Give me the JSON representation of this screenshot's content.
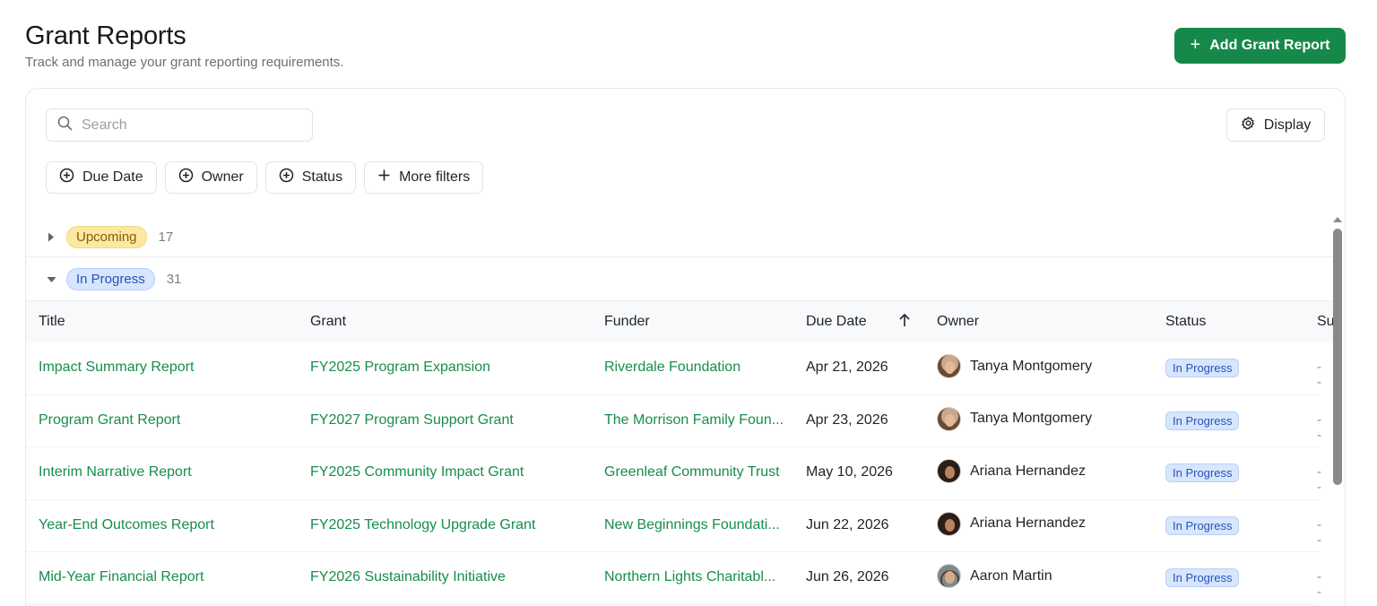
{
  "header": {
    "title": "Grant Reports",
    "subtitle": "Track and manage your grant reporting requirements.",
    "add_button": "Add Grant Report"
  },
  "toolbar": {
    "search_placeholder": "Search",
    "display_label": "Display",
    "filters": [
      "Due Date",
      "Owner",
      "Status",
      "More filters"
    ]
  },
  "groups": {
    "upcoming": {
      "label": "Upcoming",
      "count": "17",
      "expanded": false
    },
    "in_progress": {
      "label": "In Progress",
      "count": "31",
      "expanded": true
    }
  },
  "table": {
    "columns": [
      "Title",
      "Grant",
      "Funder",
      "Due Date",
      "Owner",
      "Status",
      "Su"
    ],
    "sort_column": "Due Date",
    "sort_direction": "ascending",
    "rows": [
      {
        "title": "Impact Summary Report",
        "grant": "FY2025 Program Expansion",
        "funder": "Riverdale Foundation",
        "due": "Apr 21, 2026",
        "owner": "Tanya Montgomery",
        "status": "In Progress",
        "extra": "--"
      },
      {
        "title": "Program Grant Report",
        "grant": "FY2027 Program Support Grant",
        "funder": "The Morrison Family Foun...",
        "due": "Apr 23, 2026",
        "owner": "Tanya Montgomery",
        "status": "In Progress",
        "extra": "--"
      },
      {
        "title": "Interim Narrative Report",
        "grant": "FY2025 Community Impact Grant",
        "funder": "Greenleaf Community Trust",
        "due": "May 10, 2026",
        "owner": "Ariana Hernandez",
        "status": "In Progress",
        "extra": "--"
      },
      {
        "title": "Year-End Outcomes Report",
        "grant": "FY2025 Technology Upgrade Grant",
        "funder": "New Beginnings Foundati...",
        "due": "Jun 22, 2026",
        "owner": "Ariana Hernandez",
        "status": "In Progress",
        "extra": "--"
      },
      {
        "title": "Mid-Year Financial Report",
        "grant": "FY2026 Sustainability Initiative",
        "funder": "Northern Lights Charitabl...",
        "due": "Jun 26, 2026",
        "owner": "Aaron Martin",
        "status": "In Progress",
        "extra": "--"
      }
    ]
  },
  "colors": {
    "accent": "#16894a",
    "link": "#178d4d",
    "status_in_progress_bg": "#d7e6fd",
    "status_in_progress_text": "#2753b9",
    "status_upcoming_bg": "#fbe9a3",
    "status_upcoming_text": "#8a5a00"
  },
  "icons": {
    "add": "plus-icon",
    "search": "search-icon",
    "display": "gear-icon",
    "filter_add": "plus-circle-icon",
    "collapsed": "caret-right-icon",
    "expanded": "caret-down-icon",
    "sort": "arrow-up-icon"
  }
}
